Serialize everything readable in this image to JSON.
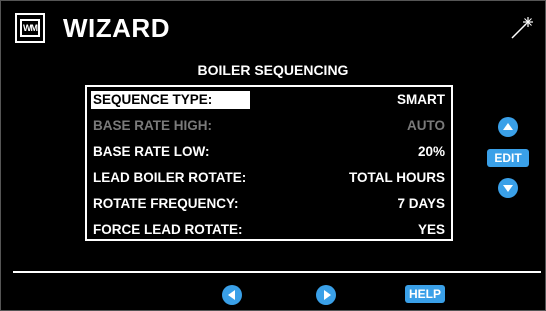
{
  "header": {
    "logo_text": "WM",
    "title": "WIZARD"
  },
  "screen": {
    "subtitle": "BOILER SEQUENCING"
  },
  "settings": [
    {
      "label": "SEQUENCE TYPE:",
      "value": "SMART",
      "state": "selected"
    },
    {
      "label": "BASE RATE HIGH:",
      "value": "AUTO",
      "state": "disabled"
    },
    {
      "label": "BASE RATE LOW:",
      "value": "20%",
      "state": "normal"
    },
    {
      "label": "LEAD BOILER ROTATE:",
      "value": "TOTAL HOURS",
      "state": "normal"
    },
    {
      "label": "ROTATE FREQUENCY:",
      "value": "7 DAYS",
      "state": "normal"
    },
    {
      "label": "FORCE LEAD ROTATE:",
      "value": "YES",
      "state": "normal"
    }
  ],
  "controls": {
    "edit_label": "EDIT",
    "help_label": "HELP"
  },
  "icons": {
    "logo": "wm-logo-icon",
    "wand": "magic-wand-icon",
    "up": "arrow-up-icon",
    "down": "arrow-down-icon",
    "prev": "arrow-left-icon",
    "next": "arrow-right-icon"
  },
  "colors": {
    "background": "#000000",
    "accent": "#3aa0e8",
    "text": "#ffffff",
    "disabled_text": "#7a7a7a"
  }
}
